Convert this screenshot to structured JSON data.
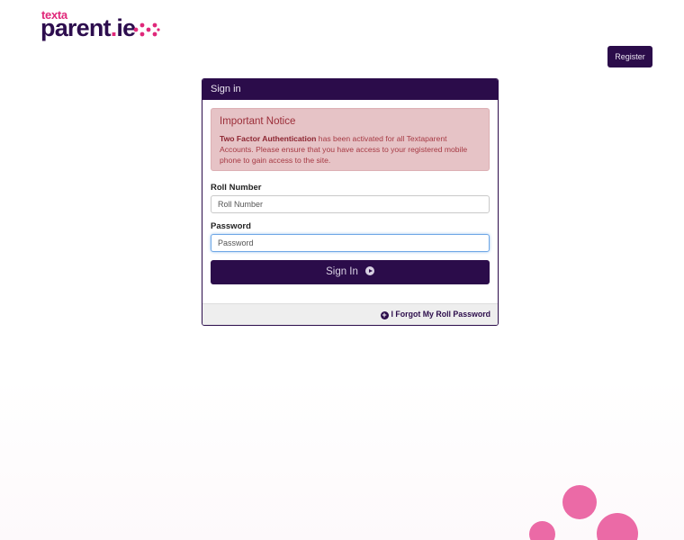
{
  "logo": {
    "top_word": "texta",
    "main_word": "parent",
    "dot": ".",
    "suffix": "ie",
    "colors": {
      "pink": "#e0287a",
      "purple": "#2d0d4e"
    }
  },
  "header": {
    "register_label": "Register"
  },
  "signin": {
    "title": "Sign in",
    "notice": {
      "title": "Important Notice",
      "bold": "Two Factor Authentication",
      "text": " has been activated for all Textaparent Accounts. Please ensure that you have access to your registered mobile phone to gain access to the site."
    },
    "roll_label": "Roll Number",
    "roll_placeholder": "Roll Number",
    "password_label": "Password",
    "password_placeholder": "Password",
    "submit_label": "Sign In",
    "forgot_label": "I Forgot My Roll Password"
  },
  "colors": {
    "brand_purple": "#2b0c4a",
    "brand_pink": "#eb6aa6",
    "notice_bg": "#e6c3c6",
    "notice_text": "#a0353f"
  },
  "icons": {
    "submit": "circle-arrow-right-icon",
    "forgot": "plus-circle-icon",
    "logo_dots": "dots-arrow-icon"
  }
}
